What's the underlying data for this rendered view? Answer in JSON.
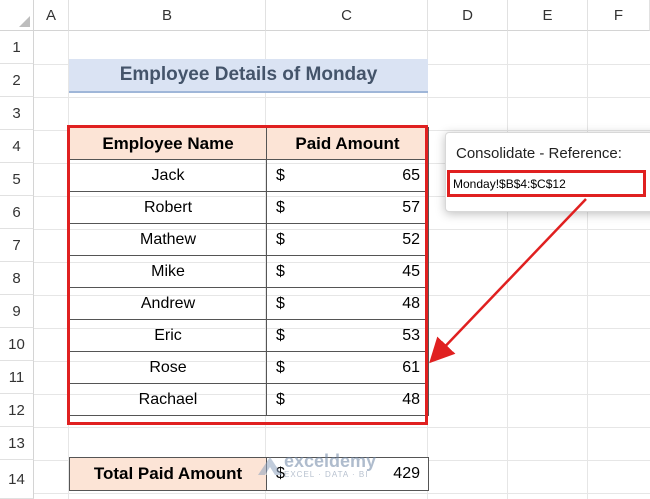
{
  "columns": [
    "A",
    "B",
    "C",
    "D",
    "E",
    "F"
  ],
  "rows": [
    "1",
    "2",
    "3",
    "4",
    "5",
    "6",
    "7",
    "8",
    "9",
    "10",
    "11",
    "12",
    "13",
    "14"
  ],
  "title": "Employee Details of Monday",
  "table": {
    "headers": [
      "Employee Name",
      "Paid Amount"
    ],
    "currency": "$",
    "rows": [
      {
        "name": "Jack",
        "amount": "65"
      },
      {
        "name": "Robert",
        "amount": "57"
      },
      {
        "name": "Mathew",
        "amount": "52"
      },
      {
        "name": "Mike",
        "amount": "45"
      },
      {
        "name": "Andrew",
        "amount": "48"
      },
      {
        "name": "Eric",
        "amount": "53"
      },
      {
        "name": "Rose",
        "amount": "61"
      },
      {
        "name": "Rachael",
        "amount": "48"
      }
    ]
  },
  "total": {
    "label": "Total Paid Amount",
    "currency": "$",
    "value": "429"
  },
  "dialog": {
    "label": "Consolidate - Reference:",
    "reference": "Monday!$B$4:$C$12"
  },
  "watermark": {
    "name": "exceldemy",
    "sub": "EXCEL · DATA · BI"
  },
  "colors": {
    "highlight": "#e02020",
    "title_bg": "#dae3f3",
    "header_bg": "#fce4d6"
  }
}
